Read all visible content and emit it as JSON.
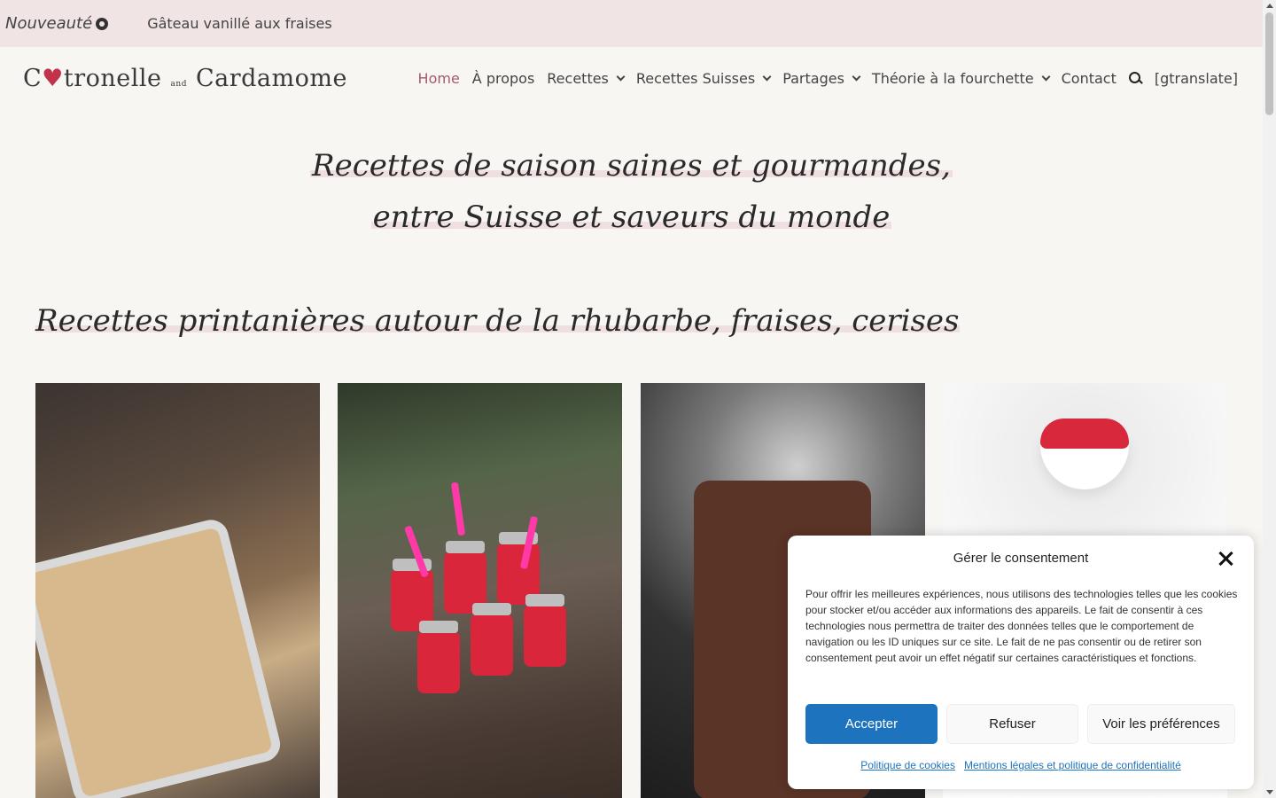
{
  "topbar": {
    "new_label": "Nouveauté",
    "latest_title": "Gâteau vanillé aux fraises"
  },
  "header": {
    "logo_part1": "C",
    "logo_part2": "tronelle",
    "logo_and": "and",
    "logo_part3": "Cardamome",
    "nav": [
      {
        "label": "Home",
        "active": true
      },
      {
        "label": "À propos"
      },
      {
        "label": "Recettes",
        "dropdown": true
      },
      {
        "label": "Recettes Suisses",
        "dropdown": true
      },
      {
        "label": "Partages",
        "dropdown": true
      },
      {
        "label": "Théorie à la fourchette",
        "dropdown": true
      },
      {
        "label": "Contact"
      },
      {
        "label": "[gtranslate]"
      }
    ]
  },
  "hero": {
    "line1": "Recettes de saison saines et gourmandes,",
    "line2": "entre Suisse et saveurs du monde"
  },
  "section": {
    "title": "Recettes printanières autour de la rhubarbe, fraises, cerises"
  },
  "consent": {
    "title": "Gérer le consentement",
    "body": "Pour offrir les meilleures expériences, nous utilisons des technologies telles que les cookies pour stocker et/ou accéder aux informations des appareils. Le fait de consentir à ces technologies nous permettra de traiter des données telles que le comportement de navigation ou les ID uniques sur ce site. Le fait de ne pas consentir ou de retirer son consentement peut avoir un effet négatif sur certaines caractéristiques et fonctions.",
    "accept": "Accepter",
    "refuse": "Refuser",
    "prefs": "Voir les préférences",
    "link_cookies": "Politique de cookies",
    "link_legal": "Mentions légales et politique de confidentialité"
  },
  "colors": {
    "topbar_bg": "#f1e4e4",
    "page_bg": "#f8f6f3",
    "accent": "#a65a6a",
    "highlight": "#efdfe0",
    "primary_button": "#1e73be"
  }
}
